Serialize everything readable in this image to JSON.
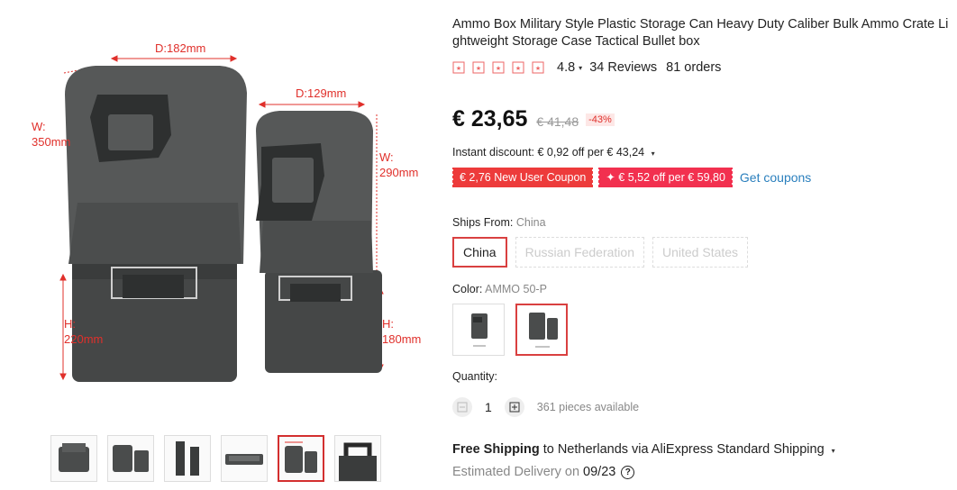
{
  "gallery": {
    "dimensions": {
      "large_depth": "D:182mm",
      "small_depth": "D:129mm",
      "large_width_label": "W:",
      "large_width_value": "350mm",
      "small_width_label": "W:",
      "small_width_value": "290mm",
      "large_height_label": "H:",
      "large_height_value": "220mm",
      "small_height_label": "H:",
      "small_height_value": "180mm"
    },
    "thumbnail_count": 6,
    "active_thumbnail": 5
  },
  "product": {
    "title": "Ammo Box Military Style Plastic Storage Can Heavy Duty Caliber Bulk Ammo Crate Lightweight Storage Case Tactical Bullet box",
    "rating": "4.8",
    "stars": 5,
    "reviews": "34 Reviews",
    "orders": "81 orders",
    "price": "€ 23,65",
    "old_price": "€ 41,48",
    "discount": "-43%",
    "instant_discount": "Instant discount: € 0,92 off per € 43,24",
    "coupons": [
      "€ 2,76 New User Coupon",
      "✦ € 5,52 off per € 59,80"
    ],
    "get_coupons": "Get coupons"
  },
  "ships_from": {
    "label": "Ships From:",
    "value": "China",
    "options": [
      "China",
      "Russian Federation",
      "United States"
    ],
    "selected": 0
  },
  "color": {
    "label": "Color:",
    "value": "AMMO 50-P",
    "selected": 1
  },
  "quantity": {
    "label": "Quantity:",
    "value": "1",
    "available": "361 pieces available"
  },
  "shipping": {
    "free": "Free Shipping",
    "text": "to Netherlands via AliExpress Standard Shipping",
    "estimated_label": "Estimated Delivery on",
    "estimated_date": "09/23"
  },
  "colors": {
    "accent": "#d94040",
    "coupon_red": "#ed3b3b",
    "coupon_pink": "#f2304f",
    "link_blue": "#2a7fbd",
    "box_dark": "#4a4c4c"
  }
}
